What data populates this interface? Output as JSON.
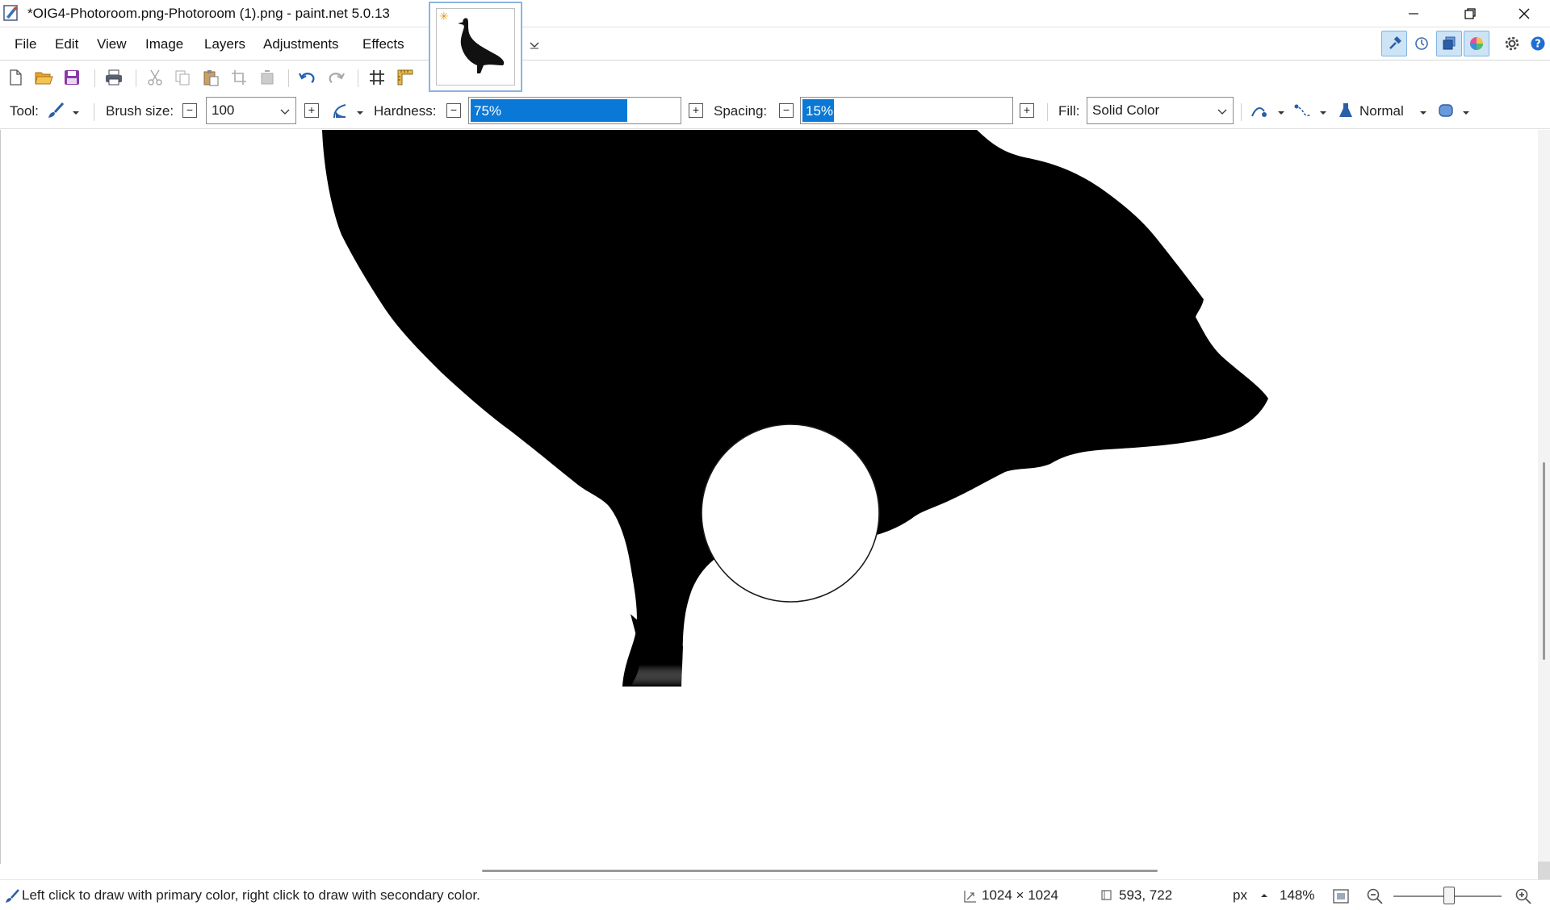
{
  "window": {
    "title": "*OIG4-Photoroom.png-Photoroom (1).png - paint.net 5.0.13"
  },
  "menu": {
    "items": [
      "File",
      "Edit",
      "View",
      "Image",
      "Layers",
      "Adjustments",
      "Effects"
    ]
  },
  "toolbar_icons": [
    "new-icon",
    "open-icon",
    "save-icon",
    "print-icon",
    "cut-icon",
    "copy-icon",
    "paste-icon",
    "crop-icon",
    "deselect-icon",
    "undo-icon",
    "redo-icon",
    "grid-icon",
    "ruler-icon"
  ],
  "tool_options": {
    "tool_label": "Tool:",
    "brush_size_label": "Brush size:",
    "brush_size_value": "100",
    "hardness_label": "Hardness:",
    "hardness_value": "75%",
    "hardness_level": 0.75,
    "spacing_label": "Spacing:",
    "spacing_value": "15%",
    "spacing_level": 0.15,
    "fill_label": "Fill:",
    "fill_value": "Solid Color",
    "blend_mode": "Normal"
  },
  "status": {
    "hint": "Left click to draw with primary color, right click to draw with secondary color.",
    "image_size": "1024 × 1024",
    "cursor_pos": "593, 722",
    "units": "px",
    "zoom": "148%"
  },
  "colors": {
    "accent": "#0a78d7",
    "active_panel": "#cde4f7"
  }
}
